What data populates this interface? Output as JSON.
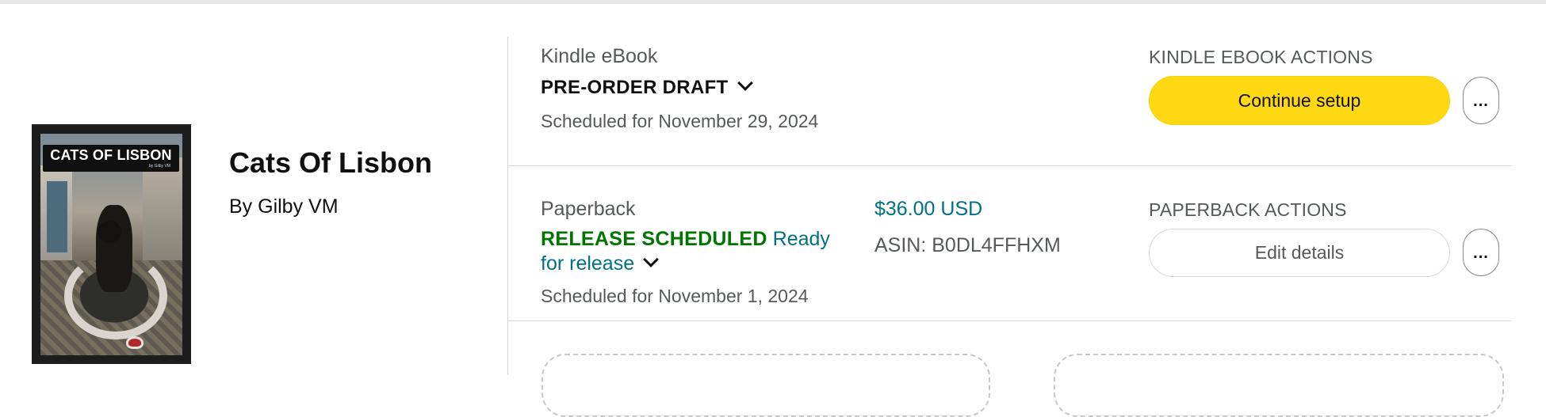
{
  "book": {
    "cover_title": "CATS OF LISBON",
    "cover_author": "by Gilby VM",
    "title": "Cats Of Lisbon",
    "author": "By Gilby VM"
  },
  "kindle": {
    "format": "Kindle eBook",
    "status": "PRE-ORDER DRAFT",
    "scheduled": "Scheduled for November 29, 2024",
    "actions_label": "KINDLE EBOOK ACTIONS",
    "primary_button": "Continue setup",
    "more_button": "..."
  },
  "paperback": {
    "format": "Paperback",
    "status": "RELEASE SCHEDULED",
    "status_detail": "Ready for release",
    "scheduled": "Scheduled for November 1, 2024",
    "price": "$36.00 USD",
    "asin": "ASIN: B0DL4FFHXM",
    "actions_label": "PAPERBACK ACTIONS",
    "secondary_button": "Edit details",
    "more_button": "..."
  },
  "colors": {
    "primary_button": "#ffd814",
    "status_green": "#007600",
    "link_teal": "#007185"
  }
}
